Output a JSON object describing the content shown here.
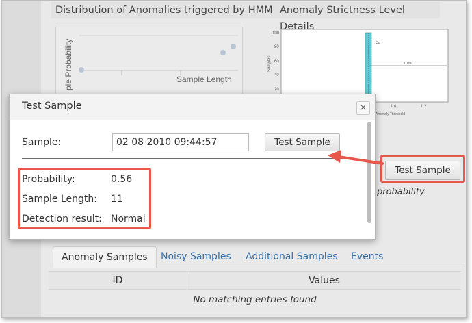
{
  "panels": {
    "left_title": "Distribution of Anomalies triggered by HMM",
    "right_title": "Anomaly Strictness Level Details"
  },
  "left_chart": {
    "ylabel": "ple Probability",
    "xlabel": "Sample Length"
  },
  "right_chart": {
    "ylabel": "Samples",
    "yticks": [
      "100",
      "80",
      "60",
      "40",
      "20"
    ],
    "xticks": [
      "1.0",
      "1.2"
    ],
    "bar_label": "3σ",
    "pct_label": "0.0%",
    "legend": "Anomaly Threshold"
  },
  "background": {
    "test_button_label": "Test Sample",
    "partial_text": "probability."
  },
  "modal": {
    "title": "Test Sample",
    "close": "×",
    "sample_label": "Sample:",
    "sample_value": "02 08 2010 09:44:57",
    "test_button_label": "Test Sample",
    "probability_label": "Probability:",
    "probability_value": "0.56",
    "length_label": "Sample Length:",
    "length_value": "11",
    "result_label": "Detection result:",
    "result_value": "Normal"
  },
  "tabs": [
    {
      "label": "Anomaly Samples",
      "active": true
    },
    {
      "label": "Noisy Samples",
      "active": false
    },
    {
      "label": "Additional Samples",
      "active": false
    },
    {
      "label": "Events",
      "active": false
    }
  ],
  "table": {
    "columns": [
      "ID",
      "Values"
    ],
    "empty_message": "No matching entries found"
  },
  "colors": {
    "highlight": "#e8574b",
    "tab_link": "#336fa8",
    "bar": "#5fcad3"
  }
}
